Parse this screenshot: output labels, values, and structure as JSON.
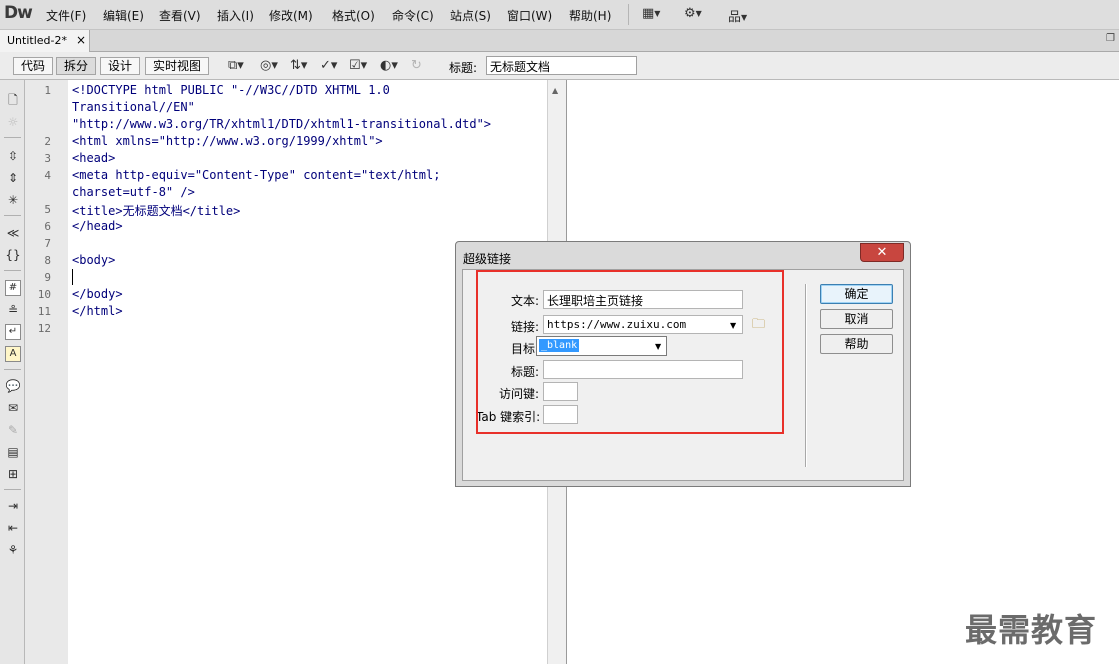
{
  "app": {
    "logo": "Dw",
    "menu": [
      "文件(F)",
      "编辑(E)",
      "查看(V)",
      "插入(I)",
      "修改(M)",
      "格式(O)",
      "命令(C)",
      "站点(S)",
      "窗口(W)",
      "帮助(H)"
    ],
    "menu_icons": [
      "layout-icon",
      "gear-icon",
      "site-icon"
    ]
  },
  "tab": {
    "label": "Untitled-2*",
    "close": "×"
  },
  "toolbar": {
    "views": [
      "代码",
      "拆分",
      "设计",
      "实时视图"
    ],
    "active_view": "拆分",
    "title_label": "标题:",
    "title_value": "无标题文档"
  },
  "code": {
    "line_numbers": [
      "1",
      "2",
      "3",
      "4",
      "5",
      "6",
      "7",
      "8",
      "9",
      "10",
      "11",
      "12"
    ],
    "lines": [
      "<!DOCTYPE html PUBLIC \"-//W3C//DTD XHTML 1.0",
      "Transitional//EN\"",
      "\"http://www.w3.org/TR/xhtml1/DTD/xhtml1-transitional.dtd\">",
      "<html xmlns=\"http://www.w3.org/1999/xhtml\">",
      "<head>",
      "<meta http-equiv=\"Content-Type\" content=\"text/html;",
      "charset=utf-8\" />",
      "<title>无标题文档</title>",
      "</head>",
      "",
      "<body>",
      "",
      "</body>",
      "</html>"
    ]
  },
  "dialog": {
    "title": "超级链接",
    "close": "✕",
    "fields": {
      "text_label": "文本:",
      "text_value": "长理职培主页链接",
      "link_label": "链接:",
      "link_value": "https://www.zuixu.com",
      "target_label": "目标:",
      "target_value": "_blank",
      "title_label": "标题:",
      "title_value": "",
      "accesskey_label": "访问键:",
      "accesskey_value": "",
      "tabindex_label": "Tab 键索引:",
      "tabindex_value": ""
    },
    "buttons": {
      "ok": "确定",
      "cancel": "取消",
      "help": "帮助"
    }
  },
  "watermark": "最需教育",
  "colors": {
    "highlight_border": "#e8302a",
    "code_text": "#00007a",
    "selection": "#3399ff"
  }
}
